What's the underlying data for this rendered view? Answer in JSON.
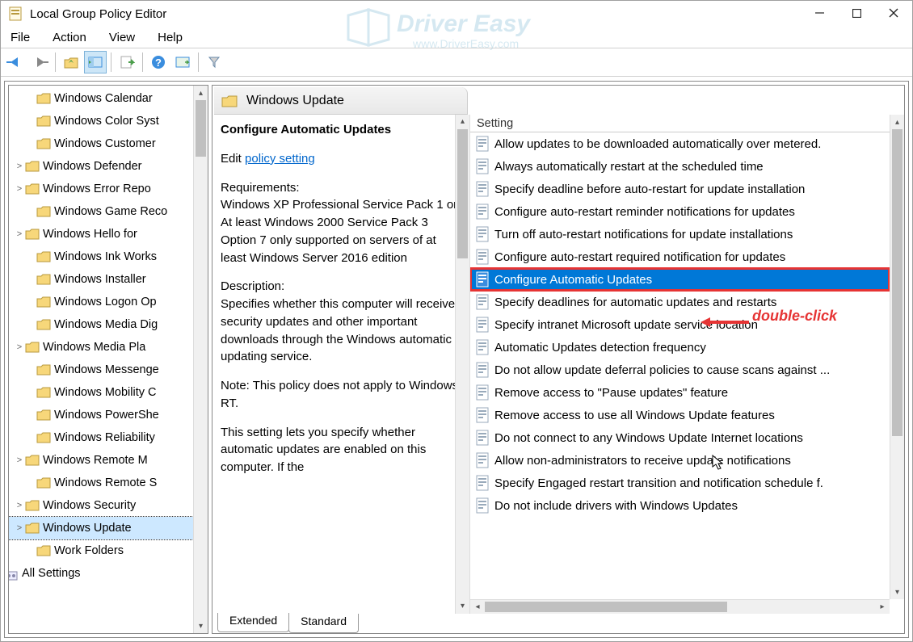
{
  "window": {
    "title": "Local Group Policy Editor"
  },
  "menubar": {
    "items": [
      "File",
      "Action",
      "View",
      "Help"
    ]
  },
  "tree": {
    "items": [
      {
        "label": "Windows Calendar",
        "exp": ""
      },
      {
        "label": "Windows Color Syst",
        "exp": ""
      },
      {
        "label": "Windows Customer",
        "exp": ""
      },
      {
        "label": "Windows Defender",
        "exp": ">"
      },
      {
        "label": "Windows Error Repo",
        "exp": ">"
      },
      {
        "label": "Windows Game Reco",
        "exp": ""
      },
      {
        "label": "Windows Hello for ",
        "exp": ">"
      },
      {
        "label": "Windows Ink Works",
        "exp": ""
      },
      {
        "label": "Windows Installer",
        "exp": ""
      },
      {
        "label": "Windows Logon Op",
        "exp": ""
      },
      {
        "label": "Windows Media Dig",
        "exp": ""
      },
      {
        "label": "Windows Media Pla",
        "exp": ">"
      },
      {
        "label": "Windows Messenge",
        "exp": ""
      },
      {
        "label": "Windows Mobility C",
        "exp": ""
      },
      {
        "label": "Windows PowerShe",
        "exp": ""
      },
      {
        "label": "Windows Reliability",
        "exp": ""
      },
      {
        "label": "Windows Remote M",
        "exp": ">"
      },
      {
        "label": "Windows Remote S",
        "exp": ""
      },
      {
        "label": "Windows Security",
        "exp": ">"
      },
      {
        "label": "Windows Update",
        "exp": ">",
        "selected": true
      },
      {
        "label": "Work Folders",
        "exp": ""
      }
    ],
    "all_settings": "All Settings"
  },
  "header": {
    "title": "Windows Update"
  },
  "description": {
    "setting_name": "Configure Automatic Updates",
    "edit_prefix": "Edit ",
    "edit_link": "policy setting",
    "req_label": "Requirements:",
    "req_text": "Windows XP Professional Service Pack 1 or At least Windows 2000 Service Pack 3 Option 7 only supported on servers of at least Windows Server 2016 edition",
    "desc_label": "Description:",
    "desc_text1": "Specifies whether this computer will receive security updates and other important downloads through the Windows automatic updating service.",
    "desc_text2": "Note: This policy does not apply to Windows RT.",
    "desc_text3": "This setting lets you specify whether automatic updates are enabled on this computer. If the"
  },
  "list": {
    "header": "Setting",
    "items": [
      {
        "label": "Allow updates to be downloaded automatically over metered."
      },
      {
        "label": "Always automatically restart at the scheduled time"
      },
      {
        "label": "Specify deadline before auto-restart for update installation"
      },
      {
        "label": "Configure auto-restart reminder notifications for updates"
      },
      {
        "label": "Turn off auto-restart notifications for update installations"
      },
      {
        "label": "Configure auto-restart required notification for updates"
      },
      {
        "label": "Configure Automatic Updates",
        "selected": true,
        "highlighted": true
      },
      {
        "label": "Specify deadlines for automatic updates and restarts"
      },
      {
        "label": "Specify intranet Microsoft update service location"
      },
      {
        "label": "Automatic Updates detection frequency"
      },
      {
        "label": "Do not allow update deferral policies to cause scans against ..."
      },
      {
        "label": "Remove access to \"Pause updates\" feature"
      },
      {
        "label": "Remove access to use all Windows Update features"
      },
      {
        "label": "Do not connect to any Windows Update Internet locations"
      },
      {
        "label": "Allow non-administrators to receive update notifications"
      },
      {
        "label": "Specify Engaged restart transition and notification schedule f."
      },
      {
        "label": "Do not include drivers with Windows Updates"
      }
    ]
  },
  "tabs": {
    "items": [
      "Extended",
      "Standard"
    ],
    "active": 0
  },
  "annotation": {
    "text": "double-click"
  },
  "watermark": {
    "brand": "Driver Easy",
    "url": "www.DriverEasy.com"
  }
}
